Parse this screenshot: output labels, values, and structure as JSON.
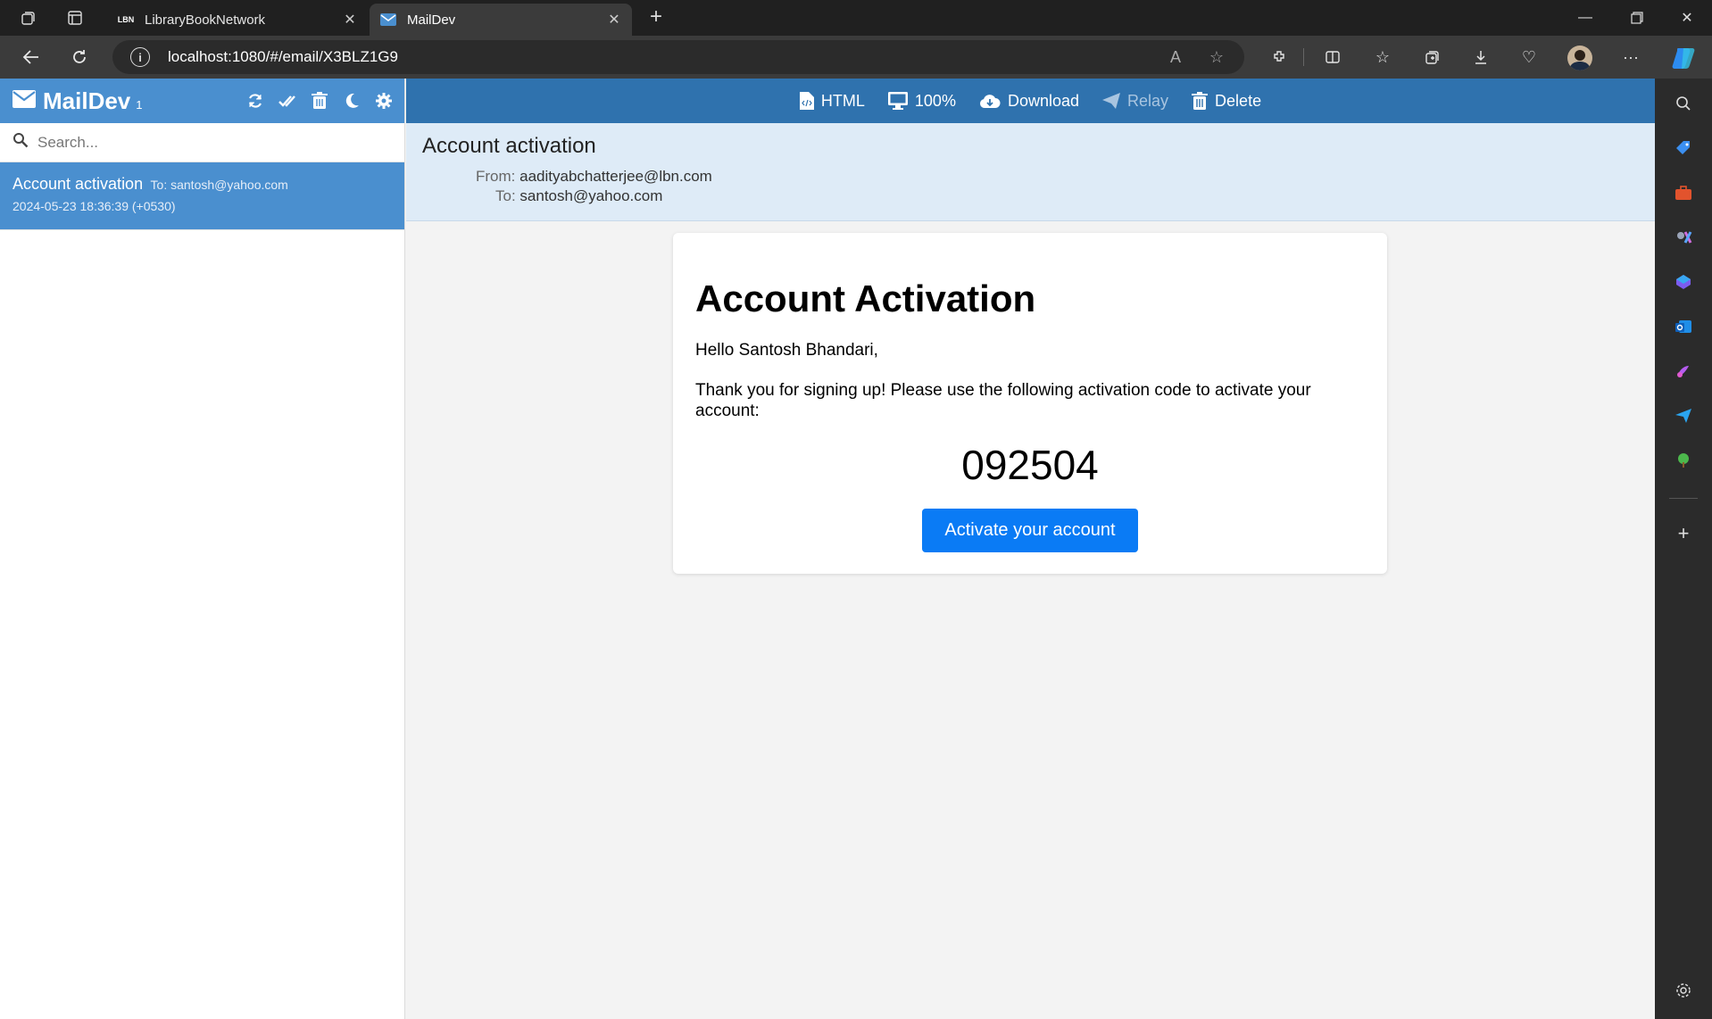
{
  "browser": {
    "tabs": [
      {
        "title": "LibraryBookNetwork",
        "favicon_text": "LBN",
        "active": false
      },
      {
        "title": "MailDev",
        "active": true
      }
    ],
    "url": "localhost:1080/#/email/X3BLZ1G9"
  },
  "maildev": {
    "logo": "MailDev",
    "count": "1",
    "search_placeholder": "Search...",
    "list": [
      {
        "subject": "Account activation",
        "to": "To: santosh@yahoo.com",
        "date": "2024-05-23 18:36:39 (+0530)"
      }
    ],
    "toolbar": {
      "html": "HTML",
      "zoom": "100%",
      "download": "Download",
      "relay": "Relay",
      "delete": "Delete"
    },
    "email": {
      "subject": "Account activation",
      "from_label": "From:",
      "from": "aadityabchatterjee@lbn.com",
      "to_label": "To:",
      "to": "santosh@yahoo.com"
    },
    "body": {
      "heading": "Account Activation",
      "greeting": "Hello Santosh Bhandari,",
      "message": "Thank you for signing up! Please use the following activation code to activate your account:",
      "code": "092504",
      "button": "Activate your account",
      "button_color": "#0a7bf5"
    }
  },
  "colors": {
    "header_blue": "#4a8fcf",
    "toolbar_blue": "#2f72ae",
    "meta_bg": "#deebf7"
  }
}
